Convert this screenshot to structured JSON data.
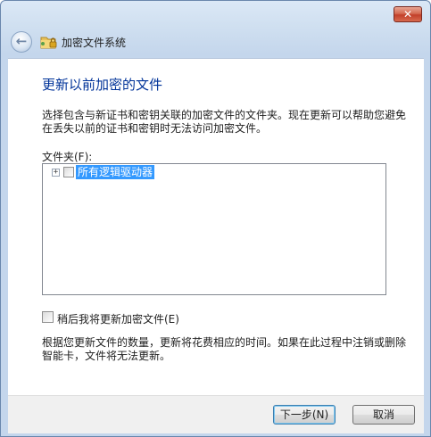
{
  "window": {
    "close_glyph": "✕"
  },
  "nav": {
    "back_glyph": "←",
    "app_icon": "encrypting-file-system-icon",
    "title": "加密文件系统"
  },
  "main": {
    "heading": "更新以前加密的文件",
    "description": "选择包含与新证书和密钥关联的加密文件的文件夹。现在更新可以帮助您避免在丢失以前的证书和密钥时无法访问加密文件。",
    "folder_label": "文件夹(F):",
    "tree": {
      "items": [
        {
          "expander": "+",
          "label": "所有逻辑驱动器",
          "checked": false,
          "selected": true
        }
      ]
    },
    "update_later": {
      "label": "稍后我将更新加密文件(E)",
      "checked": false
    },
    "note": "根据您更新文件的数量，更新将花费相应的时间。如果在此过程中注销或删除智能卡，文件将无法更新。"
  },
  "buttons": {
    "next": "下一步(N)",
    "cancel": "取消"
  },
  "colors": {
    "heading": "#003399",
    "selection": "#3399ff",
    "close_button": "#c2402a"
  }
}
